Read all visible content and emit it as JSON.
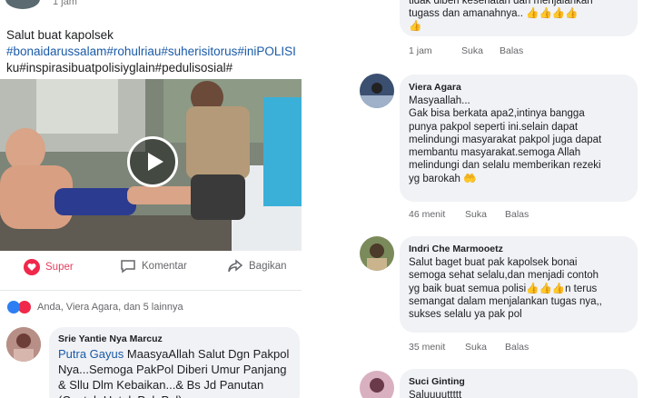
{
  "post": {
    "time": "1 jam",
    "caption_line1": "Salut buat kapolsek",
    "caption_line2": "#bonaidarussalam#rohulriau#suherisitorus#iniPOLISI",
    "caption_line3": "ku#inspirasibuatpolisiyglain#pedulisosial#",
    "actions": {
      "super": "Super",
      "komentar": "Komentar",
      "bagikan": "Bagikan"
    },
    "reactions_text": "Anda, Viera Agara, dan 5 lainnya"
  },
  "left_comment": {
    "name": "Srie Yantie Nya Marcuz",
    "mention": "Putra Gayus",
    "text": " MaasyaAllah Salut Dgn Pakpol Nya...Semoga PakPol Diberi Umur Panjang & Sllu Dlm Kebaikan...& Bs Jd Panutan (Contoh Untuk Pak Pol)"
  },
  "right_comments": [
    {
      "text": "tugass dan amanahnya.. 👍👍👍👍\n👍",
      "prev_line": "tidak diberi kesehatan dan menjalankan",
      "time": "1 jam",
      "like": "Suka",
      "reply": "Balas"
    },
    {
      "name": "Viera Agara",
      "text": "Masyaallah...\nGak bisa berkata apa2,intinya bangga\npunya pakpol seperti ini.selain dapat\nmelindungi masyarakat pakpol juga dapat\nmembantu masyarakat.semoga Allah\nmelindungi dan selalu memberikan rezeki\nyg barokah 🤲",
      "time": "46 menit",
      "like": "Suka",
      "reply": "Balas"
    },
    {
      "name": "Indri Che Marmooetz",
      "text": "Salut baget buat pak kapolsek bonai\nsemoga sehat selalu,dan menjadi contoh\nyg baik buat semua polisi👍👍👍n terus\nsemangat dalam menjalankan tugas nya,,\nsukses selalu ya pak pol",
      "time": "35 menit",
      "like": "Suka",
      "reply": "Balas"
    },
    {
      "name": "Suci Ginting",
      "text": "Saluuuuttttt"
    }
  ],
  "colors": {
    "link": "#1a5aa8",
    "bubble": "#f0f2f5",
    "love": "#f0284a",
    "like": "#2d7ef2"
  }
}
